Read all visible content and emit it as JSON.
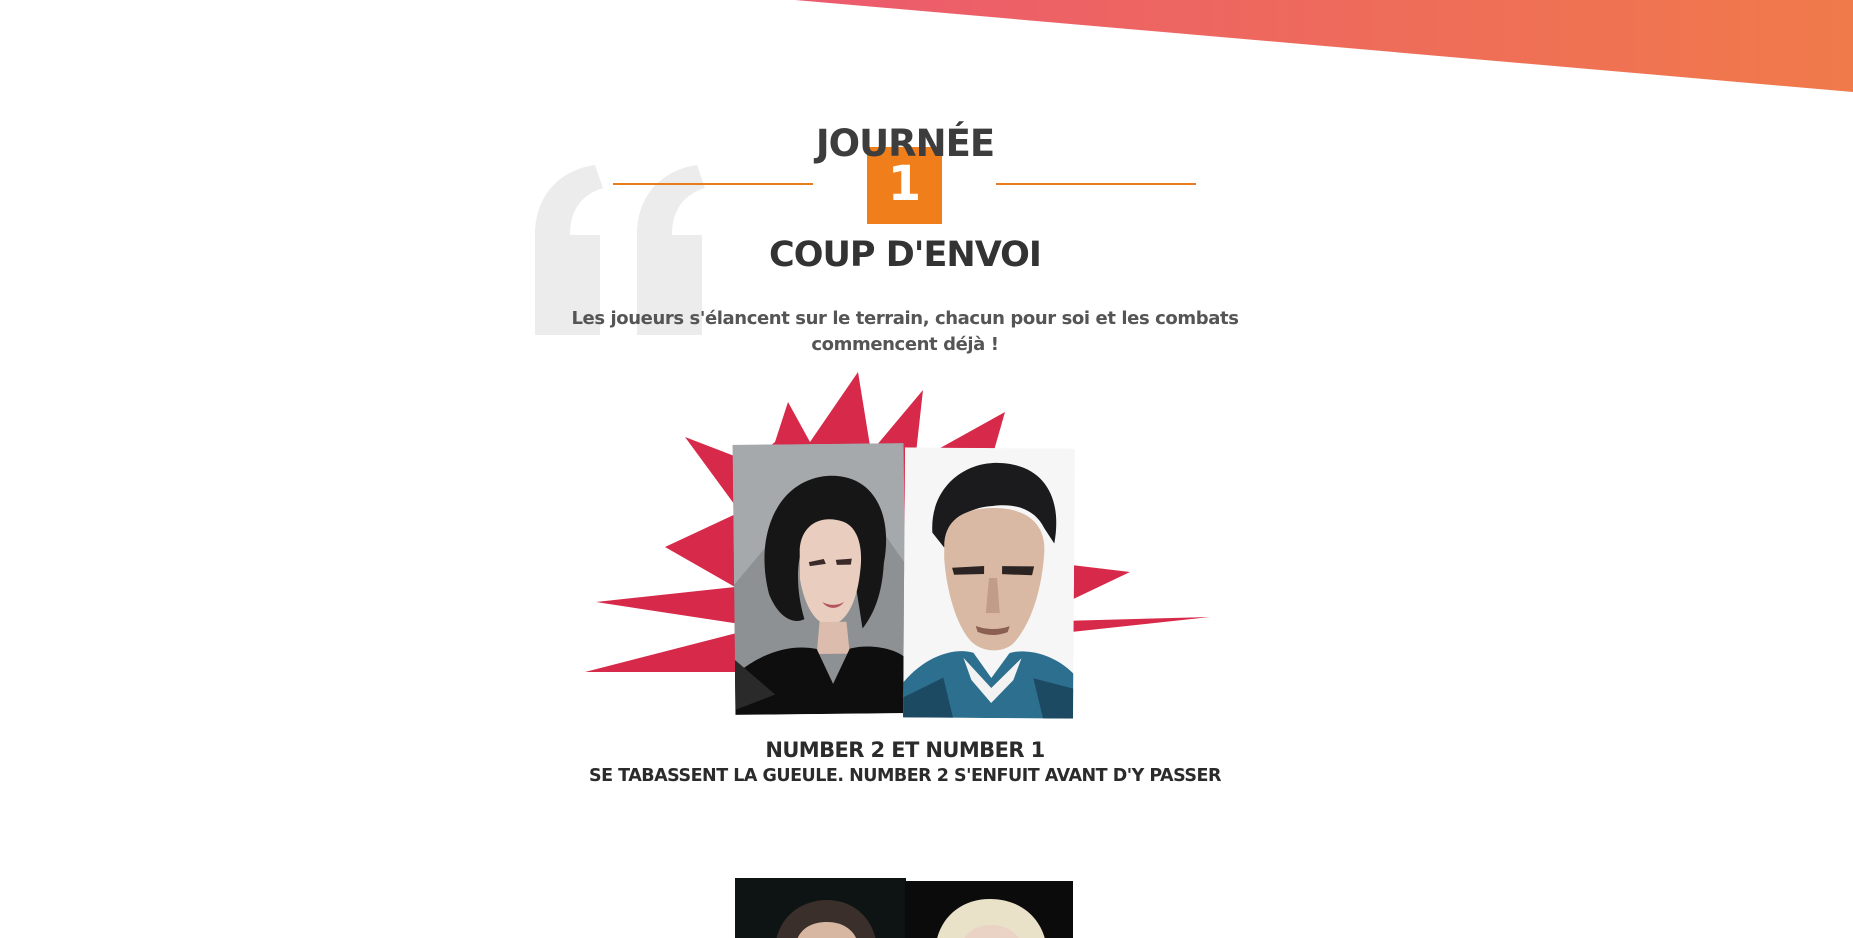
{
  "colors": {
    "accent_orange": "#f07f1b",
    "burst_red": "#d7294a",
    "banner_pink": "#ec5a6e",
    "banner_orange": "#f07a4a",
    "heading_dark": "#333333"
  },
  "day": {
    "label": "JOURNÉE",
    "number": "1",
    "title": "COUP D'ENVOI",
    "intro": "Les joueurs s'élancent sur le terrain, chacun pour soi et les combats commencent déjà !"
  },
  "matchup": {
    "names": "NUMBER 2 ET NUMBER 1",
    "description": "SE TABASSENT LA GUEULE. NUMBER 2 S'ENFUIT AVANT D'Y PASSER"
  },
  "icons": {
    "quote": "quote-mark-icon",
    "burst": "starburst-shape"
  }
}
